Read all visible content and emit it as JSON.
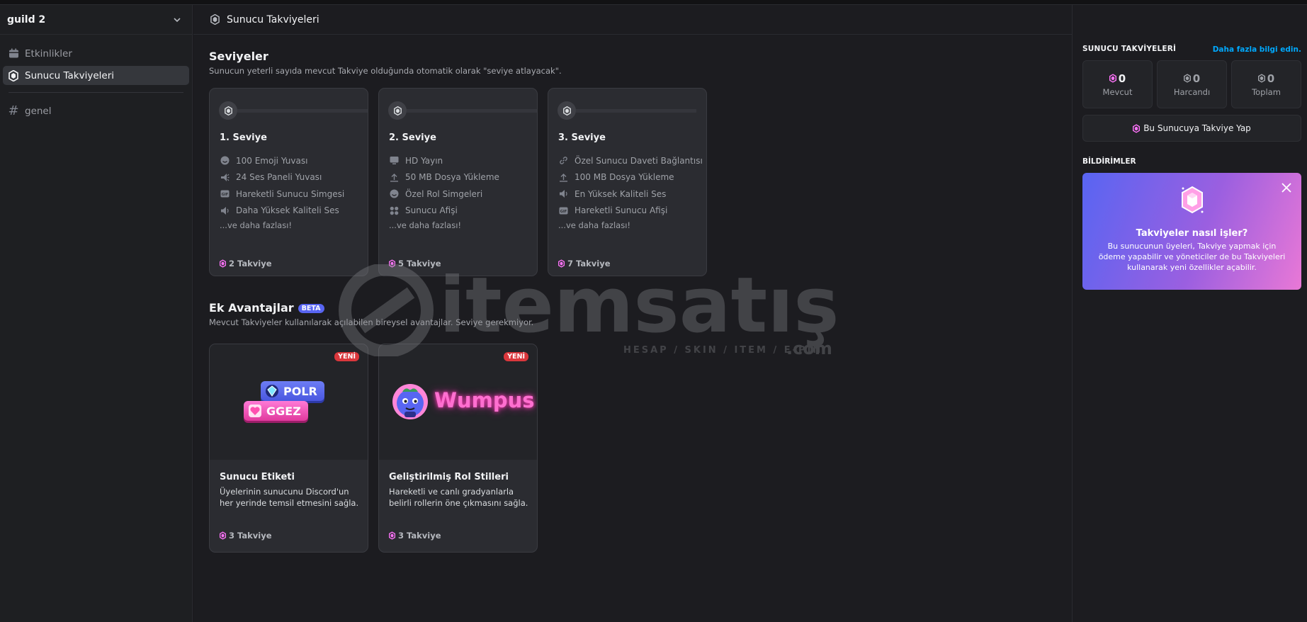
{
  "sidebar": {
    "guild_name": "guild 2",
    "items": [
      {
        "label": "Etkinlikler"
      },
      {
        "label": "Sunucu Takviyeleri"
      },
      {
        "label": "genel"
      }
    ]
  },
  "header": {
    "title": "Sunucu Takviyeleri"
  },
  "levels": {
    "title": "Seviyeler",
    "subtitle": "Sunucun yeterli sayıda mevcut Takviye olduğunda otomatik olarak \"seviye atlayacak\".",
    "tiers": [
      {
        "name": "1. Seviye",
        "perks": [
          "100 Emoji Yuvası",
          "24 Ses Paneli Yuvası",
          "Hareketli Sunucu Simgesi",
          "Daha Yüksek Kaliteli Ses"
        ],
        "more": "...ve daha fazlası!",
        "cost": "2 Takviye"
      },
      {
        "name": "2. Seviye",
        "perks": [
          "HD Yayın",
          "50 MB Dosya Yükleme",
          "Özel Rol Simgeleri",
          "Sunucu Afişi"
        ],
        "more": "...ve daha fazlası!",
        "cost": "5 Takviye"
      },
      {
        "name": "3. Seviye",
        "perks": [
          "Özel Sunucu Daveti Bağlantısı",
          "100 MB Dosya Yükleme",
          "En Yüksek Kaliteli Ses",
          "Hareketli Sunucu Afişi"
        ],
        "more": "...ve daha fazlası!",
        "cost": "7 Takviye"
      }
    ]
  },
  "extras": {
    "title": "Ek Avantajlar",
    "badge": "BETA",
    "subtitle": "Mevcut Takviyeler kullanılarak açılabilen bireysel avantajlar. Seviye gerekmiyor.",
    "cards": [
      {
        "badge": "YENİ",
        "title": "Sunucu Etiketi",
        "desc": "Üyelerinin sunucunu Discord'un her yerinde temsil etmesini sağla.",
        "cost": "3 Takviye",
        "tags": [
          "POLR",
          "GGEZ"
        ]
      },
      {
        "badge": "YENİ",
        "title": "Geliştirilmiş Rol Stilleri",
        "desc": "Hareketli ve canlı gradyanlarla belirli rollerin öne çıkmasını sağla.",
        "cost": "3 Takviye",
        "art_text": "Wumpus"
      }
    ]
  },
  "right": {
    "title": "SUNUCU TAKVİYELERİ",
    "link": "Daha fazla bilgi edin.",
    "stats": [
      {
        "value": "0",
        "label": "Mevcut"
      },
      {
        "value": "0",
        "label": "Harcandı"
      },
      {
        "value": "0",
        "label": "Toplam"
      }
    ],
    "boost_button": "Bu Sunucuya Takviye Yap",
    "notifications_title": "BİLDİRİMLER",
    "promo": {
      "title": "Takviyeler nasıl işler?",
      "body": "Bu sunucunun üyeleri, Takviye yapmak için ödeme yapabilir ve yöneticiler de bu Takviyeleri kullanarak yeni özellikler açabilir."
    }
  },
  "watermark": {
    "brand": "itemsatış",
    "tagline": "HESAP / SKIN / ITEM / E-PIN",
    "suffix": ".com"
  },
  "colors": {
    "accent": "#5865f2",
    "boost_pink": "#ff73fa",
    "link": "#00a8fc",
    "new_red": "#da373c"
  }
}
